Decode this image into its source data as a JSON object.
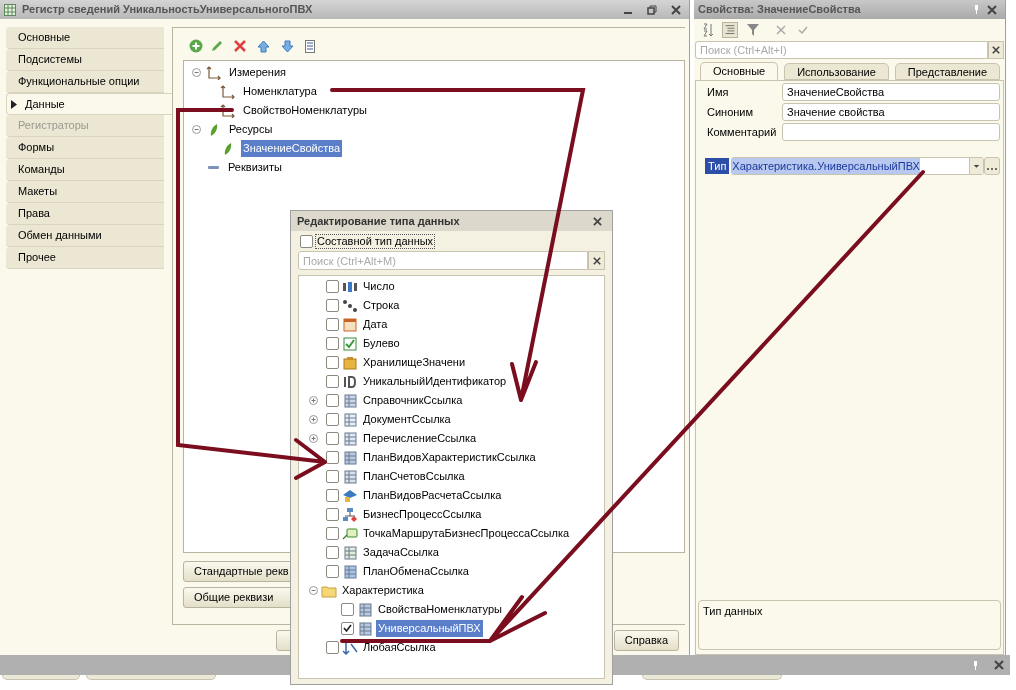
{
  "main_window": {
    "title": "Регистр сведений УникальностьУниверсальногоПВХ",
    "sidebar": [
      {
        "label": "Основные",
        "selected": false,
        "disabled": false
      },
      {
        "label": "Подсистемы",
        "selected": false,
        "disabled": false
      },
      {
        "label": "Функциональные опции",
        "selected": false,
        "disabled": false
      },
      {
        "label": "Данные",
        "selected": true,
        "disabled": false
      },
      {
        "label": "Регистраторы",
        "selected": false,
        "disabled": true
      },
      {
        "label": "Формы",
        "selected": false,
        "disabled": false
      },
      {
        "label": "Команды",
        "selected": false,
        "disabled": false
      },
      {
        "label": "Макеты",
        "selected": false,
        "disabled": false
      },
      {
        "label": "Права",
        "selected": false,
        "disabled": false
      },
      {
        "label": "Обмен данными",
        "selected": false,
        "disabled": false
      },
      {
        "label": "Прочее",
        "selected": false,
        "disabled": false
      }
    ],
    "tree": [
      {
        "label": "Измерения",
        "kind": "dimension",
        "expanded": true,
        "selected": false,
        "children": [
          {
            "label": "Номенклатура",
            "kind": "dimension",
            "selected": false
          },
          {
            "label": "СвойствоНоменклатуры",
            "kind": "dimension",
            "selected": false
          }
        ]
      },
      {
        "label": "Ресурсы",
        "kind": "resource",
        "expanded": true,
        "selected": false,
        "children": [
          {
            "label": "ЗначениеСвойства",
            "kind": "resource",
            "selected": true
          }
        ]
      },
      {
        "label": "Реквизиты",
        "kind": "attribute",
        "selected": false
      }
    ],
    "side_buttons": [
      "Стандартные рекв",
      "Общие реквизи"
    ],
    "footer_buttons": [
      "Справка"
    ]
  },
  "properties": {
    "title": "Свойства: ЗначениеСвойства",
    "search": {
      "placeholder": "Поиск (Ctrl+Alt+I)"
    },
    "tabs": [
      {
        "label": "Основные",
        "selected": true
      },
      {
        "label": "Использование",
        "selected": false
      },
      {
        "label": "Представление",
        "selected": false
      }
    ],
    "fields": [
      {
        "label": "Имя",
        "value": "ЗначениеСвойства"
      },
      {
        "label": "Синоним",
        "value": "Значение свойства"
      },
      {
        "label": "Комментарий"
      }
    ],
    "type": {
      "label": "Тип",
      "value": "Характеристика.УниверсальныйПВХ",
      "selected": true
    },
    "description": "Тип данных"
  },
  "dialog": {
    "title": "Редактирование типа данных",
    "composite": {
      "label": "Составной тип данных",
      "checked": false
    },
    "search": {
      "placeholder": "Поиск (Ctrl+Alt+M)"
    },
    "types": [
      {
        "label": "Число",
        "kind": "number",
        "checked": false,
        "selected": false
      },
      {
        "label": "Строка",
        "kind": "string",
        "checked": false,
        "selected": false
      },
      {
        "label": "Дата",
        "kind": "date",
        "checked": false,
        "selected": false
      },
      {
        "label": "Булево",
        "kind": "boolean",
        "checked": false,
        "selected": false
      },
      {
        "label": "ХранилищеЗначени",
        "kind": "storage",
        "checked": false,
        "selected": false
      },
      {
        "label": "УникальныйИдентификатор",
        "kind": "uuid",
        "checked": false,
        "selected": false
      },
      {
        "label": "СправочникСсылка",
        "kind": "catalog",
        "expanded": false,
        "checked": false,
        "selected": false
      },
      {
        "label": "ДокументСсылка",
        "kind": "document",
        "expanded": false,
        "checked": false,
        "selected": false
      },
      {
        "label": "ПеречислениеСсылка",
        "kind": "enum",
        "expanded": false,
        "checked": false,
        "selected": false
      },
      {
        "label": "ПланВидовХарактеристикСсылка",
        "kind": "chart",
        "checked": false,
        "selected": false
      },
      {
        "label": "ПланСчетовСсылка",
        "kind": "accounts",
        "checked": false,
        "selected": false
      },
      {
        "label": "ПланВидовРасчетаСсылка",
        "kind": "calc",
        "checked": false,
        "selected": false
      },
      {
        "label": "БизнесПроцессСсылка",
        "kind": "process",
        "checked": false,
        "selected": false
      },
      {
        "label": "ТочкаМаршрутаБизнесПроцессаСсылка",
        "kind": "route",
        "checked": false,
        "selected": false
      },
      {
        "label": "ЗадачаСсылка",
        "kind": "task",
        "checked": false,
        "selected": false
      },
      {
        "label": "ПланОбменаСсылка",
        "kind": "exchange",
        "checked": false,
        "selected": false
      },
      {
        "label": "Характеристика",
        "kind": "folder",
        "expanded": true,
        "selected": false,
        "children": [
          {
            "label": "СвойстваНоменклатуры",
            "kind": "chart",
            "checked": false,
            "selected": false
          },
          {
            "label": "УниверсальныйПВХ",
            "kind": "chart",
            "checked": true,
            "selected": true
          }
        ]
      },
      {
        "label": "ЛюбаяСсылка",
        "kind": "anyref",
        "checked": false,
        "selected": false
      }
    ]
  }
}
